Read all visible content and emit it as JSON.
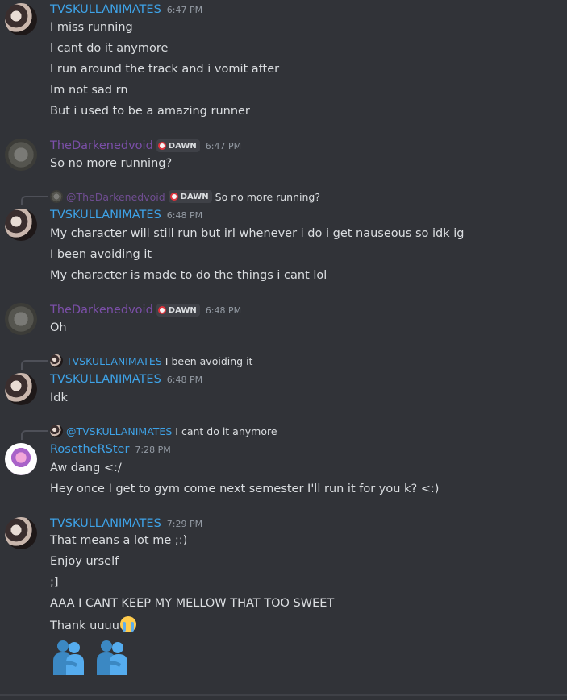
{
  "users": {
    "tv": "TVSKULLANIMATES",
    "dark": "TheDarkenedvoid",
    "rose": "RosetheRSter"
  },
  "tag_label": "DAWN",
  "groups": [
    {
      "user": "TVSKULLANIMATES",
      "time": "6:47 PM",
      "messages": [
        "I miss running",
        "I cant do it anymore",
        "I run around the track and i vomit after",
        "Im not sad rn",
        "But i used to be a amazing runner"
      ]
    },
    {
      "user": "TheDarkenedvoid",
      "time": "6:47 PM",
      "messages": [
        "So no more running?"
      ]
    },
    {
      "reply": {
        "user": "@TheDarkenedvoid",
        "text": "So no more running?"
      },
      "user": "TVSKULLANIMATES",
      "time": "6:48 PM",
      "messages": [
        "My character will still run but irl whenever i do i get nauseous so idk ig",
        "I been avoiding it",
        "My character is made to do the things i cant lol"
      ]
    },
    {
      "user": "TheDarkenedvoid",
      "time": "6:48 PM",
      "messages": [
        "Oh"
      ]
    },
    {
      "reply": {
        "user": "TVSKULLANIMATES",
        "text": "I been avoiding it"
      },
      "user": "TVSKULLANIMATES",
      "time": "6:48 PM",
      "messages": [
        "Idk"
      ]
    },
    {
      "reply": {
        "user": "@TVSKULLANIMATES",
        "text": "I cant do it anymore"
      },
      "user": "RosetheRSter",
      "time": "7:28 PM",
      "messages": [
        "Aw dang <:/",
        "Hey once I get to gym come next semester I'll run it for you k? <:)"
      ]
    },
    {
      "user": "TVSKULLANIMATES",
      "time": "7:29 PM",
      "messages": [
        "That means a lot me ;:)",
        "Enjoy urself",
        ";]",
        "AAA I CANT KEEP MY MELLOW THAT TOO SWEET",
        "Thank uuuu"
      ],
      "emoji_after_last": "loudly-crying-face",
      "big_emojis": [
        "people-hugging",
        "people-hugging"
      ]
    }
  ],
  "colors": {
    "background": "#313338",
    "username_blue": "#3ea3e8",
    "username_purple": "#7b4fa8",
    "timestamp": "#949ba4",
    "text": "#dbdee1"
  }
}
